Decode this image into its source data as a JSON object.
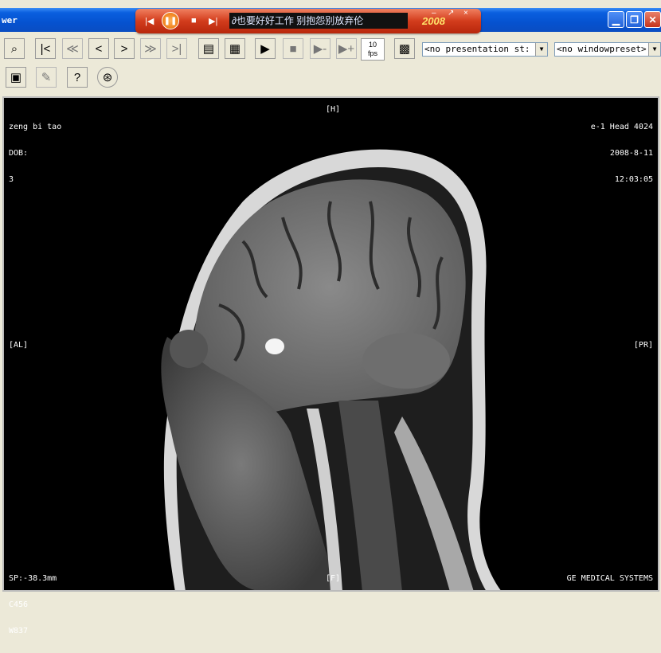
{
  "window": {
    "title": "wer"
  },
  "media_player": {
    "lyric": "∂也要好好工作  别抱怨别放弃伦",
    "logo": "2008",
    "controls": {
      "prev": "|◀",
      "pause": "❚❚",
      "stop": "■",
      "next": "▶|",
      "minimize": "–",
      "restore": "↗",
      "close": "×"
    }
  },
  "toolbar": {
    "fps_value": "10",
    "fps_unit": "fps",
    "presentation_select": "<no presentation st:",
    "windowpreset_select": "<no windowpreset>"
  },
  "viewer": {
    "top_left": [
      "zeng bi tao",
      "DOB:",
      "3"
    ],
    "top_center": "[H]",
    "top_right": [
      "e-1 Head 4024",
      "2008-8-11",
      "12:03:05"
    ],
    "left_mid": "[AL]",
    "right_mid": "[PR]",
    "bottom_left": [
      "SP:-38.3mm",
      "C456",
      "W837"
    ],
    "bottom_center": "[F]",
    "bottom_right": "GE MEDICAL SYSTEMS"
  },
  "colors": {
    "titlebar": "#0552d0",
    "media_red": "#d23c1c",
    "viewer_bg": "#000000"
  }
}
